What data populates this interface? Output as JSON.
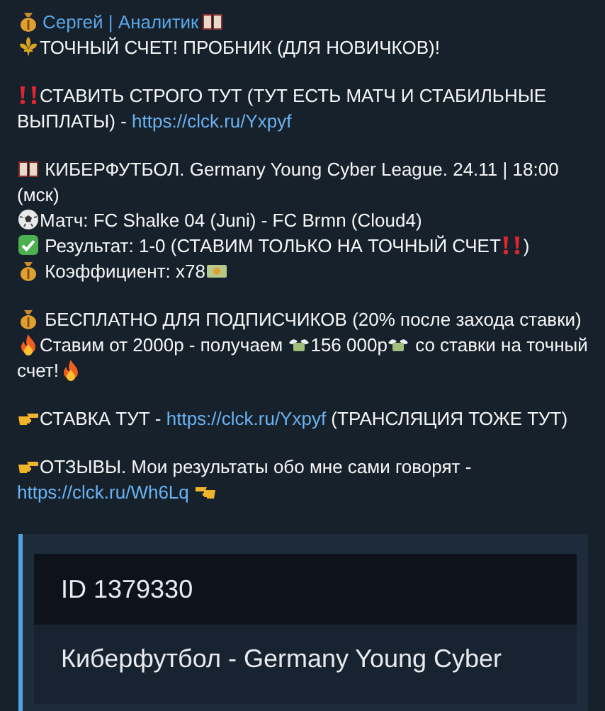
{
  "message": {
    "blocks": [
      {
        "lines": [
          {
            "parts": [
              {
                "kind": "money"
              },
              {
                "kind": "name",
                "text": "Сергей | Аналитик"
              },
              {
                "kind": "book"
              }
            ]
          },
          {
            "parts": [
              {
                "kind": "fleur"
              },
              {
                "kind": "text",
                "text": "ТОЧНЫЙ СЧЕТ! ПРОБНИК (ДЛЯ НОВИЧКОВ)!"
              }
            ]
          }
        ]
      },
      {
        "lines": [
          {
            "parts": [
              {
                "kind": "bangbang"
              },
              {
                "kind": "text",
                "text": "СТАВИТЬ СТРОГО ТУТ (ТУТ ЕСТЬ МАТЧ И СТАБИЛЬНЫЕ ВЫПЛАТЫ) - "
              },
              {
                "kind": "link",
                "text": "https://clck.ru/Yxpyf"
              }
            ]
          }
        ]
      },
      {
        "lines": [
          {
            "parts": [
              {
                "kind": "book"
              },
              {
                "kind": "text",
                "text": " КИБЕРФУТБОЛ. Germany Young Cyber League. 24.11 | 18:00 (мск)"
              }
            ]
          },
          {
            "parts": [
              {
                "kind": "ball"
              },
              {
                "kind": "text",
                "text": "Матч:  FC Shalke 04 (Juni) - FC Brmn (Cloud4)"
              }
            ]
          },
          {
            "parts": [
              {
                "kind": "check"
              },
              {
                "kind": "text",
                "text": " Результат: 1-0 (СТАВИМ ТОЛЬКО НА ТОЧНЫЙ СЧЕТ"
              },
              {
                "kind": "bangbang"
              },
              {
                "kind": "text",
                "text": ")"
              }
            ]
          },
          {
            "parts": [
              {
                "kind": "money"
              },
              {
                "kind": "text",
                "text": " Коэффициент: x78"
              },
              {
                "kind": "cash"
              }
            ]
          }
        ]
      },
      {
        "lines": [
          {
            "parts": [
              {
                "kind": "money"
              },
              {
                "kind": "text",
                "text": " БЕСПЛАТНО ДЛЯ ПОДПИСЧИКОВ (20% после захода ставки)"
              }
            ]
          },
          {
            "parts": [
              {
                "kind": "fire"
              },
              {
                "kind": "text",
                "text": "Ставим от 2000р - получаем "
              },
              {
                "kind": "wings"
              },
              {
                "kind": "text",
                "text": "156 000р"
              },
              {
                "kind": "wings"
              },
              {
                "kind": "text",
                "text": " со ставки на точный счет!"
              },
              {
                "kind": "fire"
              }
            ]
          }
        ]
      },
      {
        "lines": [
          {
            "parts": [
              {
                "kind": "pointright"
              },
              {
                "kind": "text",
                "text": "СТАВКА ТУТ -  "
              },
              {
                "kind": "link",
                "text": "https://clck.ru/Yxpyf"
              },
              {
                "kind": "text",
                "text": "  (ТРАНСЛЯЦИЯ ТОЖЕ ТУТ)"
              }
            ]
          }
        ]
      },
      {
        "lines": [
          {
            "parts": [
              {
                "kind": "pointright"
              },
              {
                "kind": "text",
                "text": "ОТЗЫВЫ. Мои результаты обо мне сами говорят - "
              },
              {
                "kind": "link",
                "text": "https://clck.ru/Wh6Lq"
              },
              {
                "kind": "pointleft"
              }
            ]
          }
        ]
      }
    ]
  },
  "preview": {
    "title": "ID 1379330",
    "text": "Киберфутбол - Germany Young Cyber"
  }
}
